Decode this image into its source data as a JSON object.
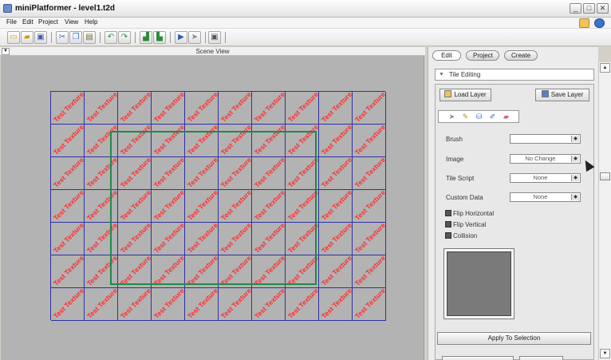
{
  "window": {
    "title": "miniPlatformer - level1.t2d",
    "controls": [
      "minimize-icon",
      "maximize-icon",
      "close-icon"
    ],
    "control_glyphs": [
      "_",
      "□",
      "✕"
    ]
  },
  "menu": {
    "items": [
      "File",
      "Edit",
      "Project",
      "View",
      "Help"
    ],
    "right_icons": [
      "message-icon",
      "info-icon"
    ]
  },
  "toolbar": {
    "icons": [
      "new-icon",
      "open-icon",
      "save-icon",
      "cut-icon",
      "copy-icon",
      "paste-icon",
      "undo-icon",
      "redo-icon",
      "import-icon",
      "export-icon",
      "play-icon",
      "select-icon",
      "monitor-icon"
    ]
  },
  "scene": {
    "title": "Scene View",
    "tile_text": "Test Texture",
    "columns": 10,
    "rows": 7
  },
  "panel": {
    "tabs": [
      "Edit",
      "Project",
      "Create"
    ],
    "active_tab": "Edit",
    "section_title": "Tile Editing",
    "load_layer": "Load Layer",
    "save_layer": "Save Layer",
    "tools": [
      "select-tool-icon",
      "paint-brush-icon",
      "fill-bucket-icon",
      "eyedropper-icon",
      "eraser-icon"
    ],
    "properties": [
      {
        "label": "Brush",
        "value": ""
      },
      {
        "label": "Image",
        "value": "No Change"
      },
      {
        "label": "Tile Script",
        "value": "None"
      },
      {
        "label": "Custom Data",
        "value": "None"
      }
    ],
    "checks": [
      "Flip Horizontal",
      "Flip Vertical",
      "Collision"
    ],
    "apply_button": "Apply To Selection"
  },
  "colors": {
    "tile_text": "#ff2c2c",
    "grid_lines": "#3030a0",
    "selection": "#1f8a4a",
    "scene_bg": "#b3b3b3"
  }
}
